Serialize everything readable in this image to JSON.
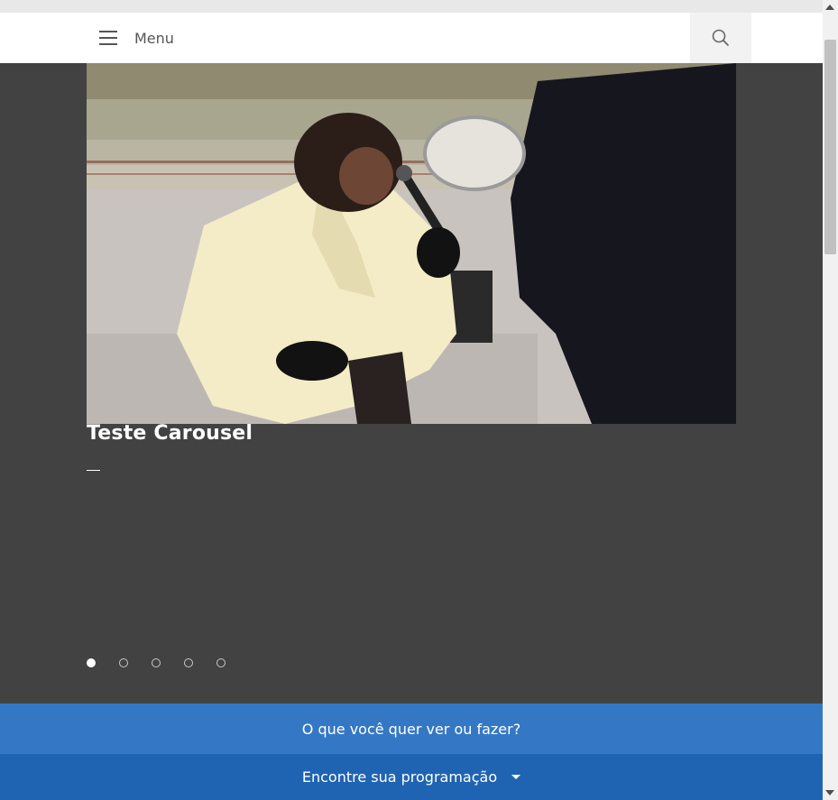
{
  "header": {
    "menu_label": "Menu",
    "menu_icon": "hamburger-icon",
    "search_icon": "search-icon"
  },
  "carousel": {
    "slide_title": "Teste Carousel",
    "slide_count": 5,
    "active_index": 0,
    "image": "photo of a singer in a cream blazer holding a microphone next to a man with a tambourine"
  },
  "cta": {
    "question": "O que você quer ver ou fazer?",
    "program_label": "Encontre sua programação",
    "program_icon": "caret-down-icon"
  },
  "colors": {
    "background": "#424242",
    "cta_blue": "#3478c5",
    "program_blue": "#1f64b2"
  }
}
